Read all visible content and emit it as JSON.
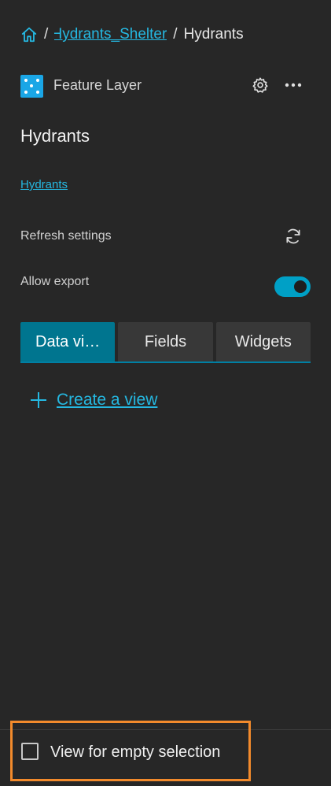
{
  "breadcrumb": {
    "parent_label": "Hydrants_Shelter",
    "current_label": "Hydrants",
    "separator": "/"
  },
  "layer": {
    "type_label": "Feature Layer",
    "title": "Hydrants",
    "source_link": "Hydrants",
    "icon_color": "#1aa6e6"
  },
  "settings": {
    "refresh_label": "Refresh settings",
    "export_label": "Allow export",
    "export_enabled": true
  },
  "tabs": [
    {
      "label": "Data vi…",
      "active": true
    },
    {
      "label": "Fields",
      "active": false
    },
    {
      "label": "Widgets",
      "active": false
    }
  ],
  "create_view_label": "Create a view",
  "footer": {
    "checkbox_label": "View for empty selection",
    "checked": false
  },
  "colors": {
    "background": "#272727",
    "accent": "#25b8e1",
    "tab_active": "#00758f",
    "toggle_on": "#00a0c6",
    "highlight": "#f28a2c"
  }
}
